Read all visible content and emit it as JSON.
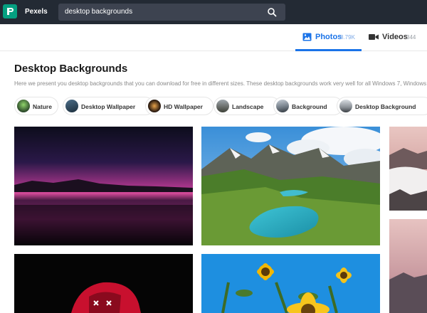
{
  "app": {
    "brand": "Pexels"
  },
  "search": {
    "query": "desktop backgrounds"
  },
  "tabs": {
    "photos": {
      "label": "Photos",
      "count": "8.79K"
    },
    "videos": {
      "label": "Videos",
      "count": "344"
    }
  },
  "page": {
    "title": "Desktop Backgrounds",
    "intro": "Here we present you desktop backgrounds that you can download for free in different sizes. These desktop backgrounds work very well for all Windows 7, Windows"
  },
  "chips": [
    {
      "label": "Nature"
    },
    {
      "label": "Desktop Wallpaper"
    },
    {
      "label": "HD Wallpaper"
    },
    {
      "label": "Landscape"
    },
    {
      "label": "Background"
    },
    {
      "label": "Desktop Background"
    }
  ],
  "colors": {
    "topbar": "#232a34",
    "brand_green": "#05a081",
    "accent": "#1a73e8"
  }
}
